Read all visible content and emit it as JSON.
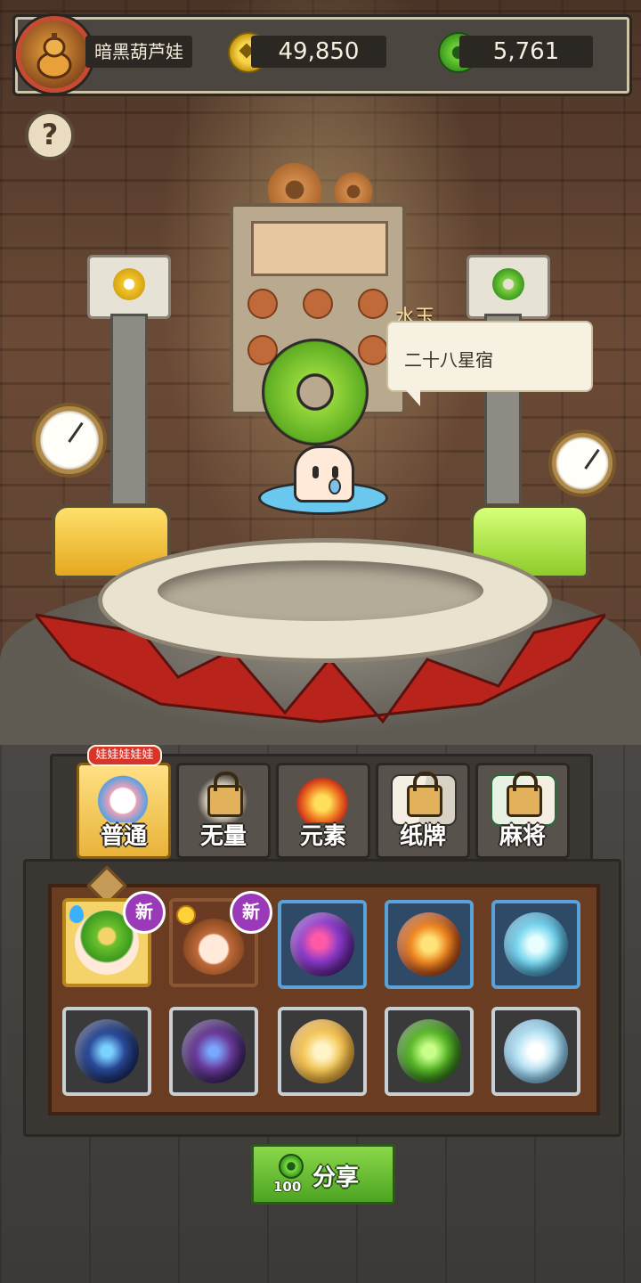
{
  "header": {
    "player_name": "暗黑葫芦娃",
    "coins": "49,850",
    "jade": "5,761",
    "avatar_icon": "gourd-icon",
    "coin_icon": "gold-coin-icon",
    "jade_icon": "jade-ring-icon"
  },
  "help": {
    "label": "?"
  },
  "showcase": {
    "item_name": "水玉",
    "speech": "二十八星宿"
  },
  "tabs": {
    "badge": "娃娃娃娃娃",
    "items": [
      {
        "label": "普通",
        "locked": false,
        "active": true
      },
      {
        "label": "无量",
        "locked": true,
        "active": false
      },
      {
        "label": "元素",
        "locked": true,
        "active": false
      },
      {
        "label": "纸牌",
        "locked": true,
        "active": false
      },
      {
        "label": "麻将",
        "locked": true,
        "active": false
      }
    ]
  },
  "collection": {
    "new_label": "新",
    "row1": [
      {
        "name": "jade-ring-doll",
        "frame": "selected",
        "new": true,
        "element": "water-drop-icon"
      },
      {
        "name": "monkey-doll",
        "frame": "brown",
        "new": true,
        "element": "sun-icon"
      },
      {
        "name": "purple-swirl-orb",
        "frame": "blue"
      },
      {
        "name": "fire-orb",
        "frame": "blue"
      },
      {
        "name": "ice-crystal-orb",
        "frame": "blue"
      }
    ],
    "row2": [
      {
        "name": "moon-crystal-orb",
        "frame": "grey"
      },
      {
        "name": "hourglass-orb",
        "frame": "grey"
      },
      {
        "name": "golden-g-orb",
        "frame": "grey"
      },
      {
        "name": "green-slime-orb",
        "frame": "grey"
      },
      {
        "name": "snowflake-orb",
        "frame": "grey"
      }
    ]
  },
  "share": {
    "label": "分享",
    "cost": "100"
  },
  "colors": {
    "accent_gold": "#f4d36a",
    "jade_green": "#5ead22",
    "badge_red": "#d8352a",
    "new_purple": "#9a3ab8"
  }
}
